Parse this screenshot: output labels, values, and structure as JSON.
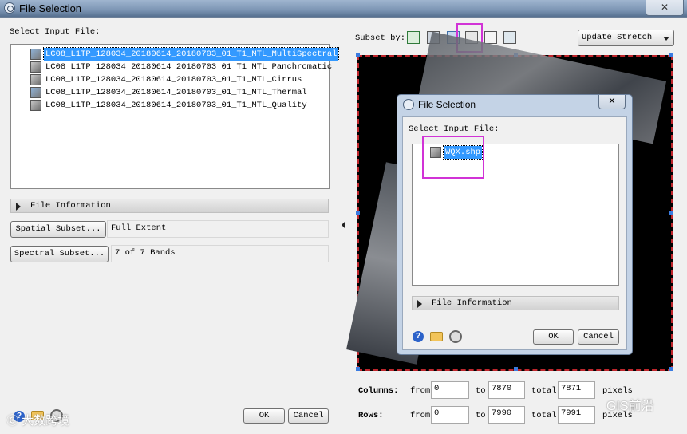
{
  "window": {
    "title": "File Selection",
    "close_glyph": "✕"
  },
  "left": {
    "select_label": "Select Input File:",
    "files": [
      "LC08_L1TP_128034_20180614_20180703_01_T1_MTL_MultiSpectral",
      "LC08_L1TP_128034_20180614_20180703_01_T1_MTL_Panchromatic",
      "LC08_L1TP_128034_20180614_20180703_01_T1_MTL_Cirrus",
      "LC08_L1TP_128034_20180614_20180703_01_T1_MTL_Thermal",
      "LC08_L1TP_128034_20180614_20180703_01_T1_MTL_Quality"
    ],
    "file_info_label": "File Information",
    "spatial_button": "Spatial Subset...",
    "spatial_value": "Full Extent",
    "spectral_button": "Spectral Subset...",
    "spectral_value": "7 of 7 Bands",
    "ok": "OK",
    "cancel": "Cancel"
  },
  "right": {
    "subset_by_label": "Subset by:",
    "toolbar_icons": [
      "rectangle-subset-icon",
      "image-subset-icon",
      "map-subset-icon",
      "shapefile-subset-icon",
      "roi-subset-icon",
      "file-subset-icon"
    ],
    "stretch_value": "Update Stretch",
    "columns_label": "Columns:",
    "rows_label": "Rows:",
    "from_label": "from",
    "to_label": "to",
    "total_label": "total",
    "pixels_label": "pixels",
    "columns": {
      "from": "0",
      "to": "7870",
      "total": "7871"
    },
    "rows": {
      "from": "0",
      "to": "7990",
      "total": "7991"
    }
  },
  "dialog": {
    "title": "File Selection",
    "close_glyph": "✕",
    "select_label": "Select Input File:",
    "file": "WQX.shp",
    "file_info_label": "File Information",
    "ok": "OK",
    "cancel": "Cancel"
  },
  "watermarks": {
    "left": "Ⓒ 大数跨境",
    "right": "GIS前沿"
  },
  "highlight_color": "#d133d6"
}
